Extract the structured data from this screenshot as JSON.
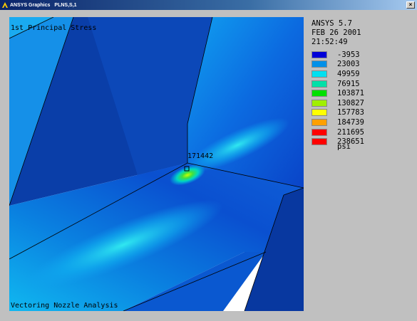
{
  "window": {
    "app_name": "ANSYS Graphics",
    "plot_command": "PLNS,S,1",
    "close_label": "×"
  },
  "plot": {
    "title": "1st Principal Stress",
    "caption": "Vectoring Nozzle Analysis",
    "max_label": "171442",
    "background_color": "#ffffff"
  },
  "info": {
    "version": "ANSYS 5.7",
    "date": "FEB 26 2001",
    "time": "21:52:49"
  },
  "legend": {
    "units": "psi",
    "items": [
      {
        "value": "-3953",
        "color": "#0000d8"
      },
      {
        "value": "23003",
        "color": "#0090e8"
      },
      {
        "value": "49959",
        "color": "#00e0f0"
      },
      {
        "value": "76915",
        "color": "#00e0a8"
      },
      {
        "value": "103871",
        "color": "#00e000"
      },
      {
        "value": "130827",
        "color": "#a0f000"
      },
      {
        "value": "157783",
        "color": "#ffff00"
      },
      {
        "value": "184739",
        "color": "#ffa000"
      },
      {
        "value": "211695",
        "color": "#ff0000"
      },
      {
        "value": "238651",
        "color": "#ff0000"
      }
    ]
  }
}
